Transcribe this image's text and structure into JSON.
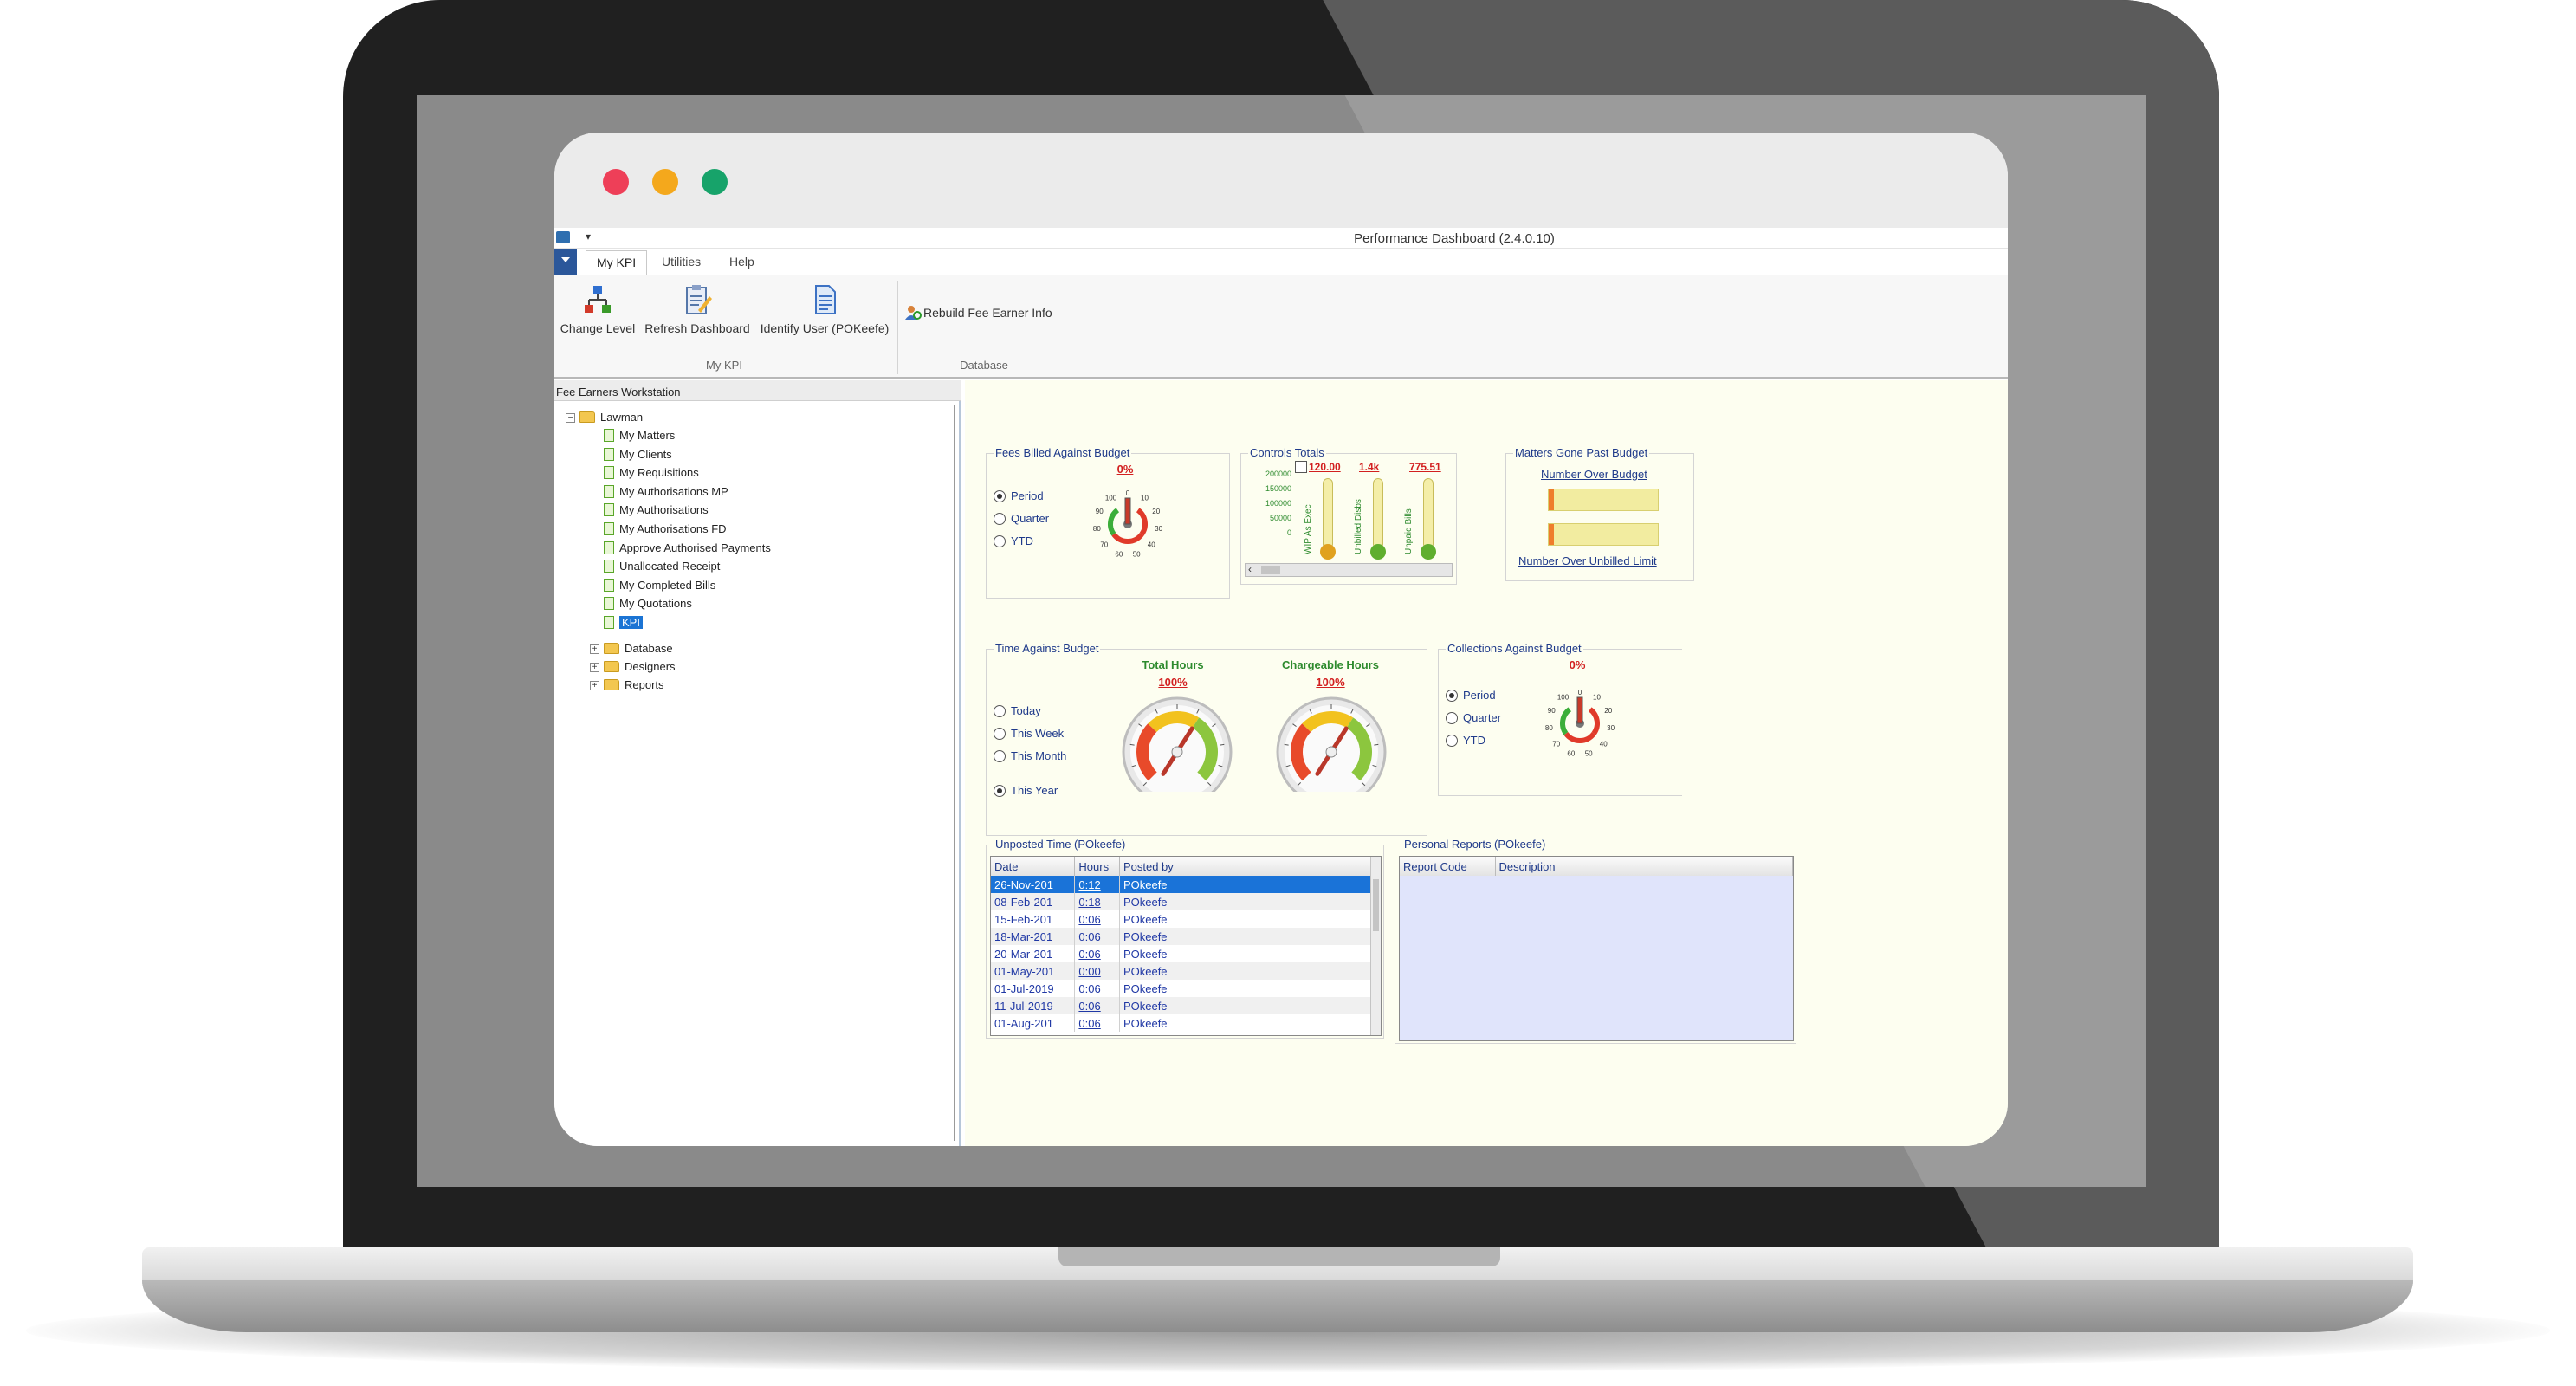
{
  "app": {
    "title": "Performance Dashboard (2.4.0.10)",
    "qat_arrow": "▾"
  },
  "tabs": [
    {
      "label": "My KPI",
      "active": true
    },
    {
      "label": "Utilities",
      "active": false
    },
    {
      "label": "Help",
      "active": false
    }
  ],
  "ribbon": {
    "change_level": "Change Level",
    "refresh_dashboard": "Refresh Dashboard",
    "identify_user": "Identify User (POKeefe)",
    "rebuild_fee_earner": "Rebuild Fee Earner Info",
    "group_my_kpi": "My KPI",
    "group_database": "Database"
  },
  "left_pane": {
    "title": "Fee Earners Workstation",
    "root": "Lawman",
    "items": [
      "My Matters",
      "My Clients",
      "My Requisitions",
      "My Authorisations MP",
      "My Authorisations",
      "My Authorisations FD",
      "Approve Authorised Payments",
      "Unallocated Receipt",
      "My Completed Bills",
      "My Quotations",
      "KPI"
    ],
    "folders": [
      "Database",
      "Designers",
      "Reports"
    ],
    "selected": "KPI"
  },
  "fees_billed": {
    "title": "Fees Billed Against Budget",
    "percent": "0%",
    "options": [
      "Period",
      "Quarter",
      "YTD"
    ],
    "selected": "Period",
    "gauge_labels": [
      "0",
      "10",
      "20",
      "30",
      "40",
      "50",
      "60",
      "70",
      "80",
      "90",
      "100"
    ]
  },
  "controls_totals": {
    "title": "Controls Totals",
    "y_ticks": [
      "200000",
      "150000",
      "100000",
      "50000",
      "0"
    ],
    "bars": [
      {
        "label": "WIP As Exec",
        "value": "120.00"
      },
      {
        "label": "Unbilled Disbs",
        "value": "1.4k"
      },
      {
        "label": "Unpaid Bills",
        "value": "775.51"
      }
    ]
  },
  "matters_past_budget": {
    "title": "Matters Gone Past Budget",
    "link1": "Number Over Budget",
    "link2": "Number Over Unbilled Limit"
  },
  "time_against_budget": {
    "title": "Time Against Budget",
    "options": [
      "Today",
      "This Week",
      "This Month",
      "This Year"
    ],
    "selected": "This Year",
    "gauge1": {
      "label": "Total Hours",
      "percent": "100%"
    },
    "gauge2": {
      "label": "Chargeable Hours",
      "percent": "100%"
    }
  },
  "collections": {
    "title": "Collections Against Budget",
    "percent": "0%",
    "options": [
      "Period",
      "Quarter",
      "YTD"
    ],
    "selected": "Period"
  },
  "unposted_time": {
    "title": "Unposted Time (POkeefe)",
    "columns": [
      "Date",
      "Hours",
      "Posted by"
    ],
    "rows": [
      [
        "26-Nov-201",
        "0:12",
        "POkeefe"
      ],
      [
        "08-Feb-201",
        "0:18",
        "POkeefe"
      ],
      [
        "15-Feb-201",
        "0:06",
        "POkeefe"
      ],
      [
        "18-Mar-201",
        "0:06",
        "POkeefe"
      ],
      [
        "20-Mar-201",
        "0:06",
        "POkeefe"
      ],
      [
        "01-May-201",
        "0:00",
        "POkeefe"
      ],
      [
        "01-Jul-2019",
        "0:06",
        "POkeefe"
      ],
      [
        "11-Jul-2019",
        "0:06",
        "POkeefe"
      ],
      [
        "01-Aug-201",
        "0:06",
        "POkeefe"
      ]
    ]
  },
  "personal_reports": {
    "title": "Personal Reports (POkeefe)",
    "columns": [
      "Report Code",
      "Description"
    ]
  },
  "colors": {
    "accent_blue": "#1a73d8",
    "label_navy": "#1f3a8a",
    "alert_red": "#d21f1f",
    "ok_green": "#2e8b2e",
    "dashboard_bg": "#fdfef0"
  }
}
